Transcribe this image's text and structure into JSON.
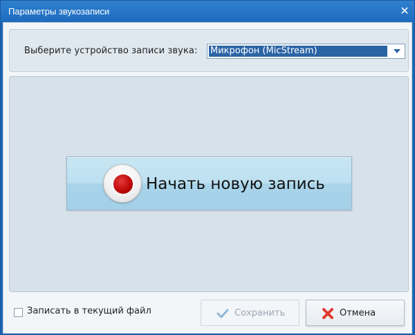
{
  "window": {
    "title": "Параметры звукозаписи"
  },
  "device": {
    "label": "Выберите устройство записи звука:",
    "selected": "Микрофон (MicStream)"
  },
  "record_button": {
    "label": "Начать новую запись"
  },
  "footer": {
    "checkbox_label": "Записать в текущий файл",
    "checkbox_checked": false,
    "save_label": "Сохранить",
    "save_enabled": false,
    "cancel_label": "Отмена"
  },
  "colors": {
    "titlebar": "#1e6bbf",
    "selection": "#2b64a5",
    "record_dot": "#c10a0a",
    "cancel_icon": "#e03a2f",
    "check_icon": "#8fb6d6"
  },
  "icons": {
    "close": "close-icon",
    "dropdown": "chevron-down-icon",
    "record": "record-icon",
    "save": "checkmark-icon",
    "cancel": "cross-icon"
  }
}
